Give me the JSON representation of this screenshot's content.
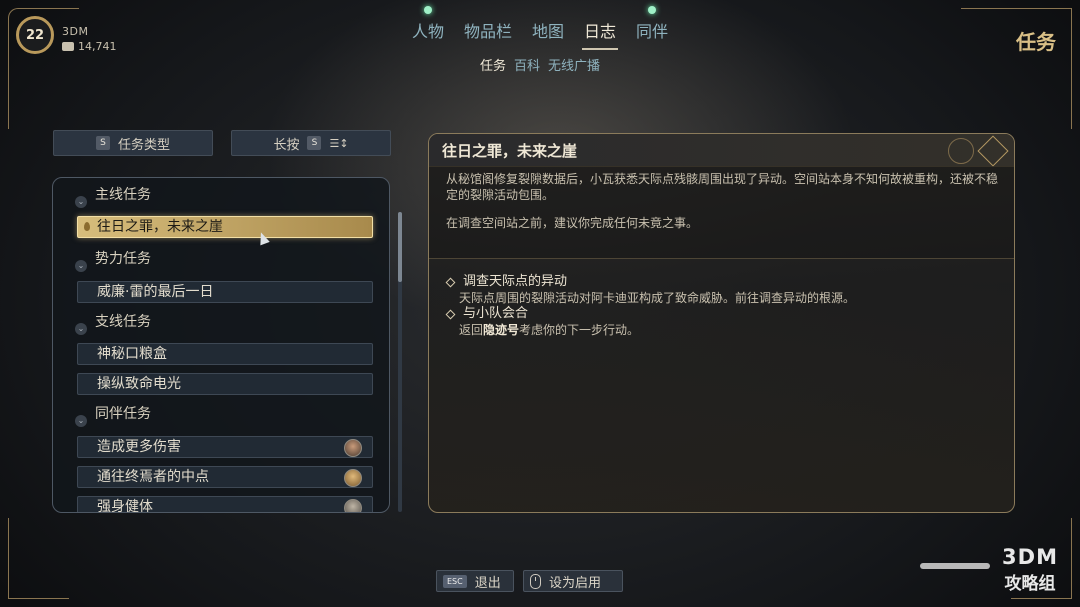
{
  "player": {
    "level": "22",
    "name": "3DM",
    "credits": "14,741"
  },
  "nav": {
    "tabs": [
      {
        "label": "人物",
        "notify": true
      },
      {
        "label": "物品栏",
        "notify": false
      },
      {
        "label": "地图",
        "notify": false
      },
      {
        "label": "日志",
        "notify": false,
        "active": true
      },
      {
        "label": "同伴",
        "notify": true
      }
    ],
    "subtabs": [
      {
        "label": "任务",
        "active": true
      },
      {
        "label": "百科"
      },
      {
        "label": "无线广播"
      }
    ],
    "page_title": "任务"
  },
  "filters": {
    "type_key": "S",
    "type_label": "任务类型",
    "hold_label": "长按",
    "hold_key": "S"
  },
  "quest_list": {
    "categories": [
      "主线任务",
      "势力任务",
      "支线任务",
      "同伴任务"
    ],
    "quests": {
      "main_0": "往日之罪，未来之崖",
      "faction_0": "威廉·雷的最后一日",
      "side_0": "神秘口粮盒",
      "side_1": "操纵致命电光",
      "comp_0": "造成更多伤害",
      "comp_1": "通往终焉者的中点",
      "comp_2": "强身健体"
    }
  },
  "detail": {
    "title": "往日之罪，未来之崖",
    "desc_1": "从秘馆阁修复裂隙数据后，小瓦获悉天际点残骸周围出现了异动。空间站本身不知何故被重构，还被不稳定的裂隙活动包围。",
    "desc_2": "在调查空间站之前，建议你完成任何未竟之事。",
    "objectives": [
      {
        "title": "调查天际点的异动",
        "desc": "天际点周围的裂隙活动对阿卡迪亚构成了致命威胁。前往调查异动的根源。"
      },
      {
        "title": "与小队会合",
        "desc_pre": "返回",
        "desc_bold": "隐迹号",
        "desc_post": "考虑你的下一步行动。"
      }
    ]
  },
  "bottom": {
    "exit_key": "ESC",
    "exit_label": "退出",
    "set_active_label": "设为启用"
  },
  "watermark": {
    "top": "3DM",
    "bottom": "攻略组"
  }
}
